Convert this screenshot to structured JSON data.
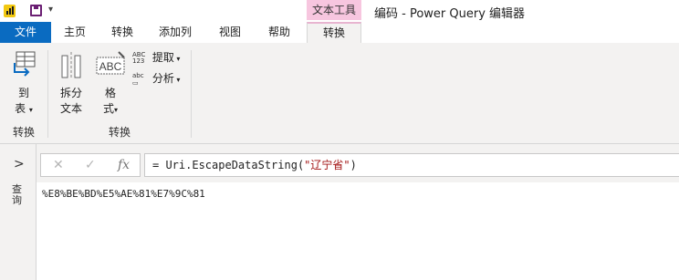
{
  "title_bar": {
    "context_tab_group": "文本工具",
    "window_title": "编码 - Power Query 编辑器",
    "qat_dropdown_glyph": "▾"
  },
  "tabs": [
    {
      "label": "文件"
    },
    {
      "label": "主页"
    },
    {
      "label": "转换"
    },
    {
      "label": "添加列"
    },
    {
      "label": "视图"
    },
    {
      "label": "帮助"
    },
    {
      "label": "转换",
      "active": true
    }
  ],
  "ribbon": {
    "groups": [
      {
        "label": "转换",
        "buttons": [
          {
            "line1": "到",
            "line2": "表"
          }
        ]
      },
      {
        "label": "转换",
        "buttons": [
          {
            "line1": "拆分",
            "line2": "文本"
          },
          {
            "line1": "格",
            "line2": "式"
          }
        ],
        "small_buttons": [
          {
            "label": "提取"
          },
          {
            "label": "分析"
          }
        ]
      }
    ],
    "icon_text": {
      "abc_upper": "ABC",
      "abc_123": "ABC\n123",
      "abc_small": "abc"
    }
  },
  "queries_pane": {
    "chevron": ">",
    "label": "查询"
  },
  "formula_bar": {
    "cancel_glyph": "✕",
    "commit_glyph": "✓",
    "fx_label": "fx",
    "formula_prefix": "= Uri.EscapeDataString(",
    "formula_string": "\"辽宁省\"",
    "formula_suffix": ")"
  },
  "result": {
    "value": "%E8%BE%BD%E5%AE%81%E7%9C%81"
  },
  "colors": {
    "file_tab": "#0a6bc1",
    "context_tab": "#f7c6df",
    "ribbon_bg": "#f3f2f1",
    "pbi_logo": "#f2c811"
  }
}
